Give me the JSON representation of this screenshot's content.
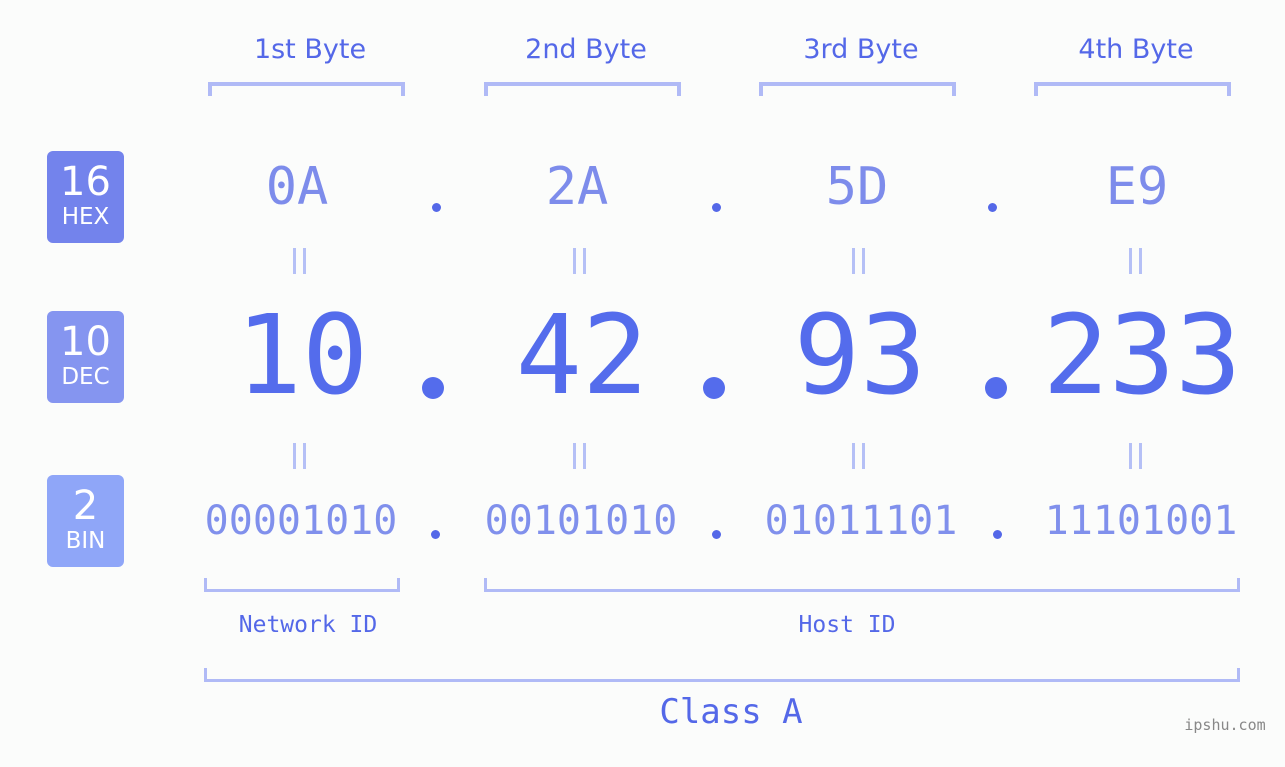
{
  "byte_headers": [
    "1st Byte",
    "2nd Byte",
    "3rd Byte",
    "4th Byte"
  ],
  "badges": [
    {
      "number": "16",
      "name": "HEX",
      "color": "#7383ec"
    },
    {
      "number": "10",
      "name": "DEC",
      "color": "#8595f0"
    },
    {
      "number": "2",
      "name": "BIN",
      "color": "#8fa6f8"
    }
  ],
  "hex": [
    "0A",
    "2A",
    "5D",
    "E9"
  ],
  "dec": [
    "10",
    "42",
    "93",
    "233"
  ],
  "bin": [
    "00001010",
    "00101010",
    "01011101",
    "11101001"
  ],
  "labels": {
    "network_id": "Network ID",
    "host_id": "Host ID",
    "class": "Class A"
  },
  "watermark": "ipshu.com",
  "colors": {
    "accent": "#546cec",
    "bracket": "#b0baf6",
    "background": "#fbfcfb"
  }
}
